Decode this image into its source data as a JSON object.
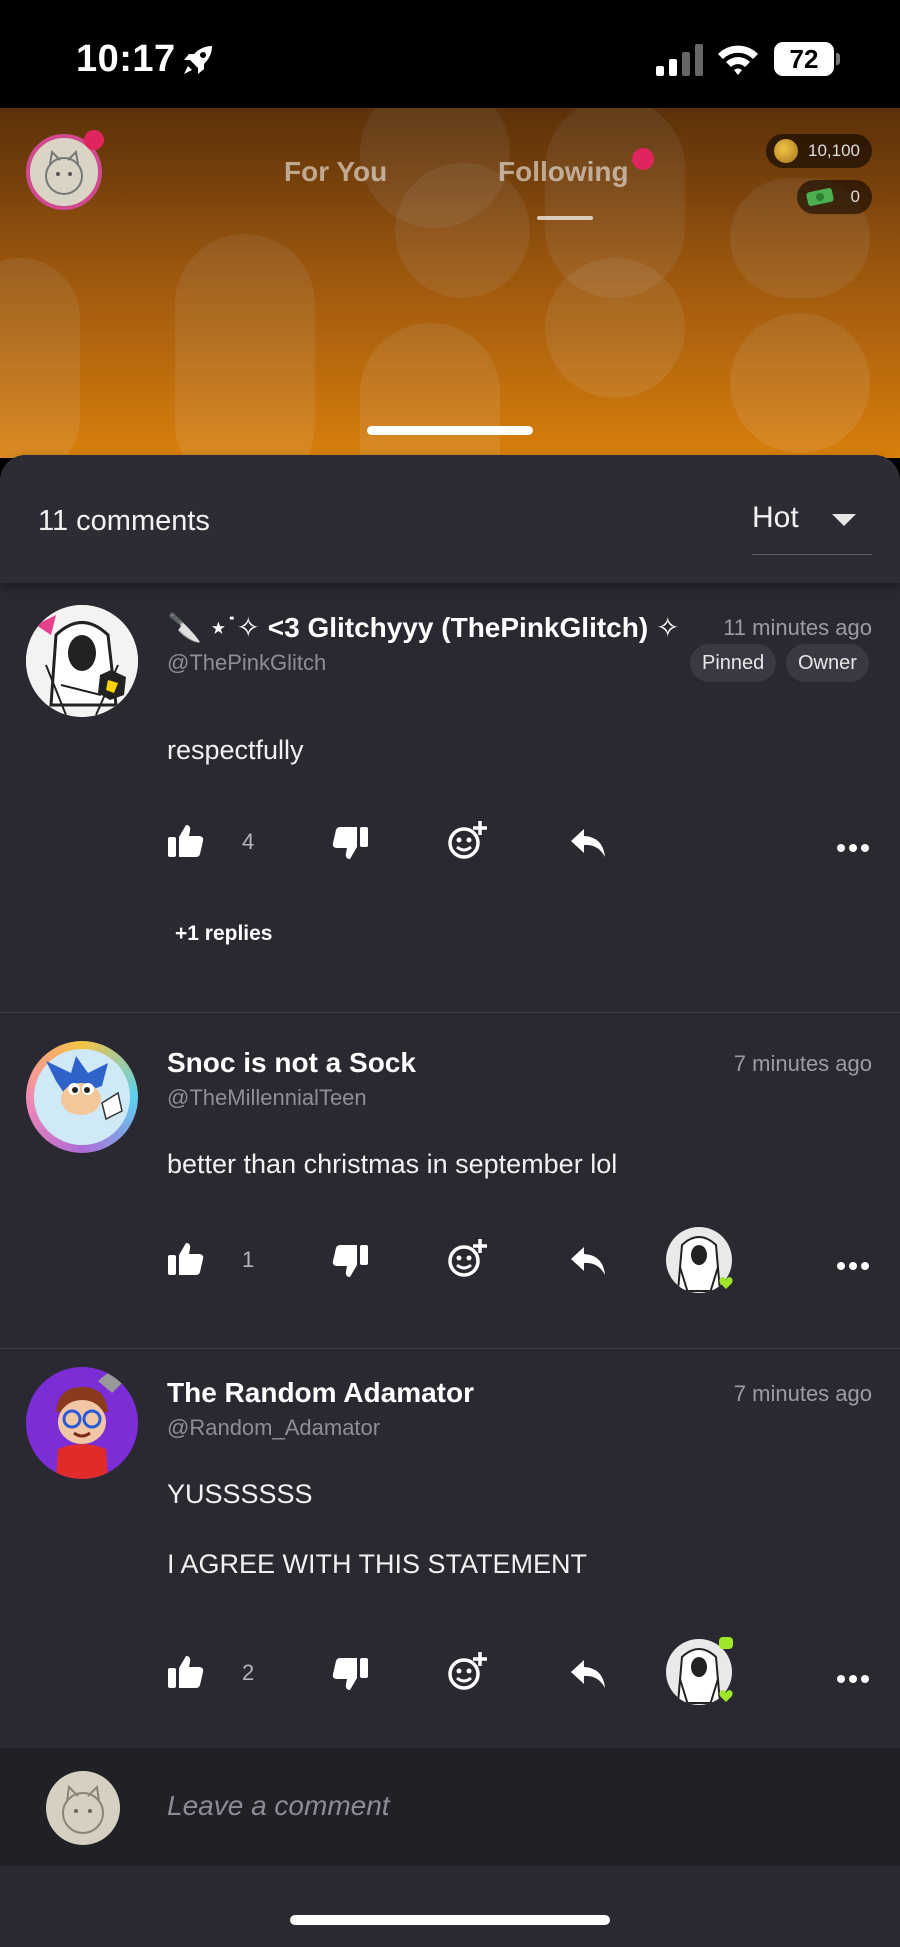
{
  "status_bar": {
    "time": "10:17",
    "battery": "72"
  },
  "header": {
    "tabs": [
      {
        "label": "For You",
        "active": false
      },
      {
        "label": "Following",
        "active": true
      }
    ],
    "coins": "10,100",
    "cash": "0",
    "colors": {
      "notification_dot": "#e0245e",
      "header_gradient_bottom": "#e4860c"
    }
  },
  "comments_sheet": {
    "count_label": "11 comments",
    "sort": {
      "selected": "Hot"
    },
    "comments": [
      {
        "name": "🔪 ⋆˙✧ <3 Glitchyyy (ThePinkGlitch) ✧",
        "handle": "@ThePinkGlitch",
        "time": "11 minutes ago",
        "badges": [
          "Pinned",
          "Owner"
        ],
        "body": [
          "respectfully"
        ],
        "likes": "4",
        "replies_label": "+1 replies"
      },
      {
        "name": "Snoc is not a Sock",
        "handle": "@TheMillennialTeen",
        "time": "7 minutes ago",
        "body": [
          "better than christmas in september lol"
        ],
        "likes": "1"
      },
      {
        "name": "The Random Adamator",
        "handle": "@Random_Adamator",
        "time": "7 minutes ago",
        "body": [
          "YUSSSSSS",
          "I AGREE WITH THIS STATEMENT"
        ],
        "likes": "2"
      }
    ]
  },
  "compose": {
    "placeholder": "Leave a comment"
  }
}
